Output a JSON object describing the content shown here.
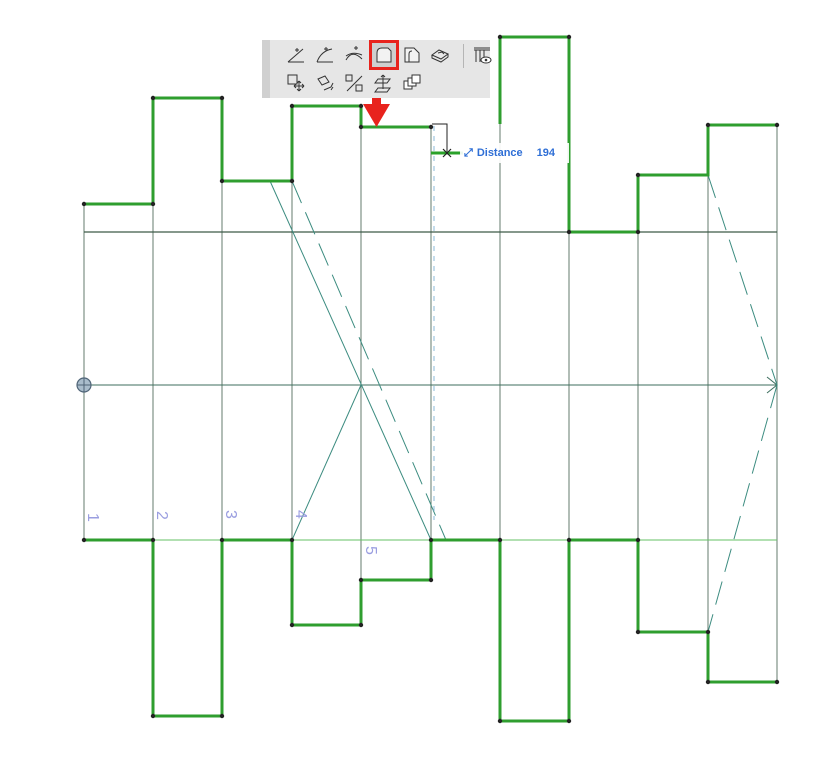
{
  "palette": {
    "tools": [
      {
        "id": "tool-line-tangent-icon"
      },
      {
        "id": "tool-arc-tangent-icon"
      },
      {
        "id": "tool-curve-tangent-icon"
      },
      {
        "id": "tool-fillet-icon",
        "active": true
      },
      {
        "id": "tool-chamfer-icon"
      },
      {
        "id": "tool-3d-offset-icon"
      },
      {
        "id": "tool-railing-eye-icon"
      },
      {
        "id": "tool-move-icon"
      },
      {
        "id": "tool-rotate-icon"
      },
      {
        "id": "tool-mirror-icon"
      },
      {
        "id": "tool-elevate-icon"
      },
      {
        "id": "tool-multiply-icon"
      }
    ],
    "highlight_color": "#e8231d"
  },
  "tracker": {
    "label": "Distance",
    "value": "194"
  },
  "drawing": {
    "division_labels": [
      "1",
      "2",
      "3",
      "4",
      "5"
    ],
    "outline_color": "#33aa33",
    "guide_color": "#2e8b6a"
  }
}
